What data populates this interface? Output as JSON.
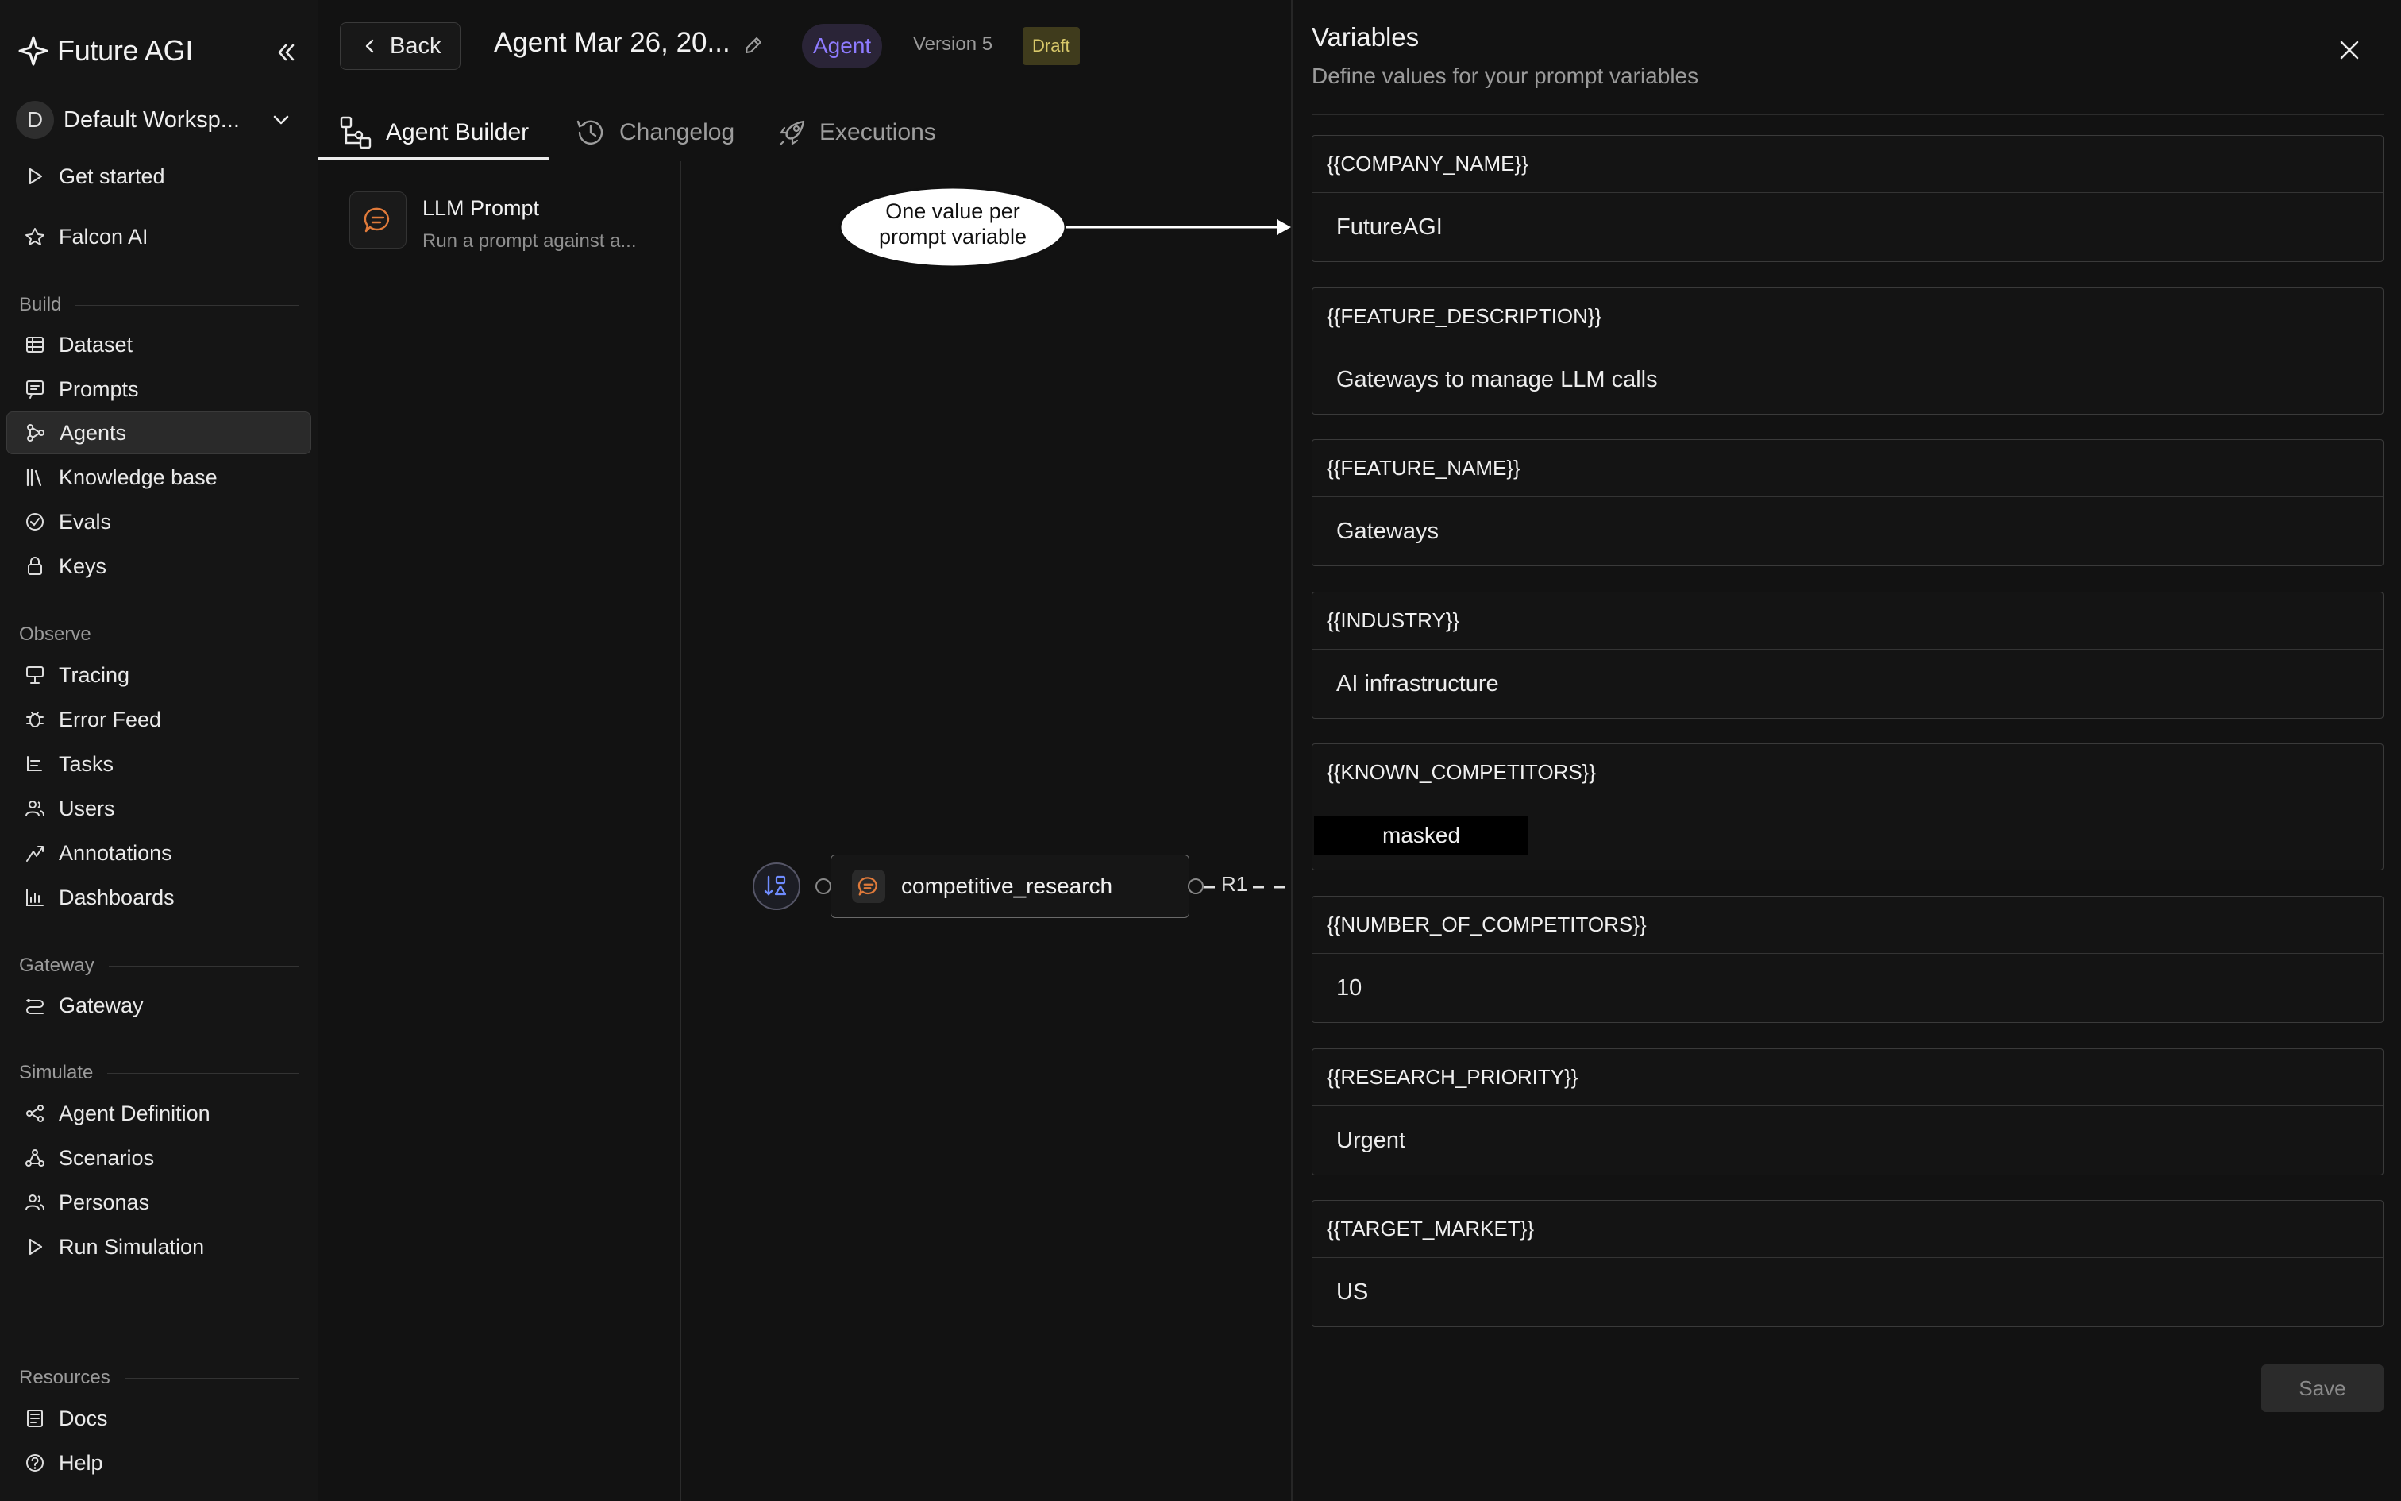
{
  "brand": {
    "name": "Future AGI"
  },
  "workspace": {
    "initial": "D",
    "name": "Default Worksp..."
  },
  "nav_top": [
    {
      "label": "Get started",
      "icon": "play-icon"
    },
    {
      "label": "Falcon AI",
      "icon": "falcon-icon"
    }
  ],
  "sections": {
    "build": {
      "label": "Build",
      "items": [
        {
          "label": "Dataset",
          "icon": "table-icon"
        },
        {
          "label": "Prompts",
          "icon": "prompt-icon"
        },
        {
          "label": "Agents",
          "icon": "agents-icon",
          "active": true
        },
        {
          "label": "Knowledge base",
          "icon": "library-icon"
        },
        {
          "label": "Evals",
          "icon": "check-circle-icon"
        },
        {
          "label": "Keys",
          "icon": "lock-icon"
        }
      ]
    },
    "observe": {
      "label": "Observe",
      "items": [
        {
          "label": "Tracing",
          "icon": "tracing-icon"
        },
        {
          "label": "Error Feed",
          "icon": "bug-icon"
        },
        {
          "label": "Tasks",
          "icon": "tasks-icon"
        },
        {
          "label": "Users",
          "icon": "users-icon"
        },
        {
          "label": "Annotations",
          "icon": "annotation-icon"
        },
        {
          "label": "Dashboards",
          "icon": "bar-chart-icon"
        }
      ]
    },
    "gateway": {
      "label": "Gateway",
      "items": [
        {
          "label": "Gateway",
          "icon": "gateway-icon"
        }
      ]
    },
    "simulate": {
      "label": "Simulate",
      "items": [
        {
          "label": "Agent Definition",
          "icon": "agent-definition-icon"
        },
        {
          "label": "Scenarios",
          "icon": "scenarios-icon"
        },
        {
          "label": "Personas",
          "icon": "personas-icon"
        },
        {
          "label": "Run Simulation",
          "icon": "play-icon"
        }
      ]
    },
    "resources": {
      "label": "Resources",
      "items": [
        {
          "label": "Docs",
          "icon": "docs-icon"
        },
        {
          "label": "Help",
          "icon": "help-icon"
        }
      ]
    }
  },
  "topbar": {
    "back_label": "Back",
    "agent_title": "Agent Mar 26, 20...",
    "agent_badge": "Agent",
    "version": "Version 5",
    "status": "Draft"
  },
  "tabs": [
    {
      "label": "Agent Builder",
      "active": true
    },
    {
      "label": "Changelog"
    },
    {
      "label": "Executions"
    }
  ],
  "node_library": [
    {
      "title": "LLM Prompt",
      "description": "Run a prompt against a..."
    }
  ],
  "canvas": {
    "callout_line1": "One value per",
    "callout_line2": "prompt variable",
    "node_label": "competitive_research",
    "edge_label": "R1"
  },
  "drawer": {
    "title": "Variables",
    "subtitle": "Define values for your prompt variables",
    "save_label": "Save",
    "variables": [
      {
        "name": "{{COMPANY_NAME}}",
        "value": "FutureAGI"
      },
      {
        "name": "{{FEATURE_DESCRIPTION}}",
        "value": "Gateways to manage LLM calls"
      },
      {
        "name": "{{FEATURE_NAME}}",
        "value": "Gateways"
      },
      {
        "name": "{{INDUSTRY}}",
        "value": "AI infrastructure"
      },
      {
        "name": "{{KNOWN_COMPETITORS}}",
        "value": "masked",
        "masked": true
      },
      {
        "name": "{{NUMBER_OF_COMPETITORS}}",
        "value": "10"
      },
      {
        "name": "{{RESEARCH_PRIORITY}}",
        "value": "Urgent"
      },
      {
        "name": "{{TARGET_MARKET}}",
        "value": "US"
      }
    ]
  },
  "colors": {
    "accent": "#8e7bff",
    "draft_bg": "#3f3b1c",
    "draft_text": "#d8c86a",
    "background": "#121212"
  }
}
